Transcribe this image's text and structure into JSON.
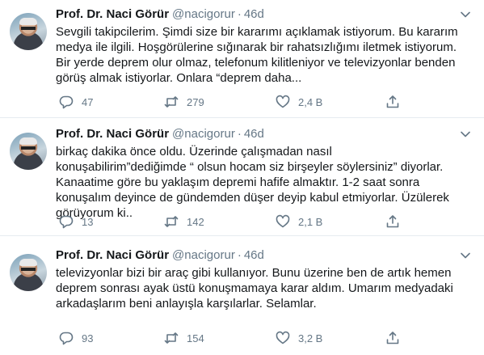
{
  "tweets": [
    {
      "name": "Prof. Dr. Naci Görür",
      "handle": "@nacigorur",
      "separator": "·",
      "time": "46d",
      "lines": [
        "Sevgili takipcilerim. Şimdi size bir kararımı açıklamak istiyorum. Bu kararım",
        "medya ile ilgili. Hoşgörülerine sığınarak bir rahatsızlığımı iletmek istiyorum.",
        "Bir yerde deprem olur olmaz, telefonum kilitleniyor ve televizyonlar benden",
        "görüş almak istiyorlar. Onlara “deprem daha..."
      ],
      "replies": "47",
      "retweets": "279",
      "likes": "2,4 B"
    },
    {
      "name": "Prof. Dr. Naci Görür",
      "handle": "@nacigorur",
      "separator": "·",
      "time": "46d",
      "lines": [
        "birkaç dakika önce oldu. Üzerinde çalışmadan nasıl",
        "konuşabilirim”dediğimde “ olsun hocam siz birşeyler söylersiniz” diyorlar.",
        "Kanaatime göre bu yaklaşım depremi hafife almaktır. 1-2 saat sonra",
        "konuşalım deyince de gündemden düşer deyip kabul etmiyorlar. Üzülerek",
        "görüyorum ki.."
      ],
      "replies": "13",
      "retweets": "142",
      "likes": "2,1 B"
    },
    {
      "name": "Prof. Dr. Naci Görür",
      "handle": "@nacigorur",
      "separator": "·",
      "time": "46d",
      "lines": [
        "televizyonlar bizi bir araç gibi kullanıyor. Bunu üzerine ben de artık hemen",
        "deprem sonrası ayak üstü konuşmamaya karar aldım. Umarım medyadaki",
        "arkadaşlarım beni anlayışla karşılarlar. Selamlar."
      ],
      "replies": "93",
      "retweets": "154",
      "likes": "3,2 B"
    }
  ],
  "colors": {
    "text": "#14171a",
    "secondary": "#657786",
    "divider": "#e6ecf0"
  },
  "icons": [
    "reply-icon",
    "retweet-icon",
    "like-icon",
    "share-icon",
    "chevron-down-icon"
  ]
}
